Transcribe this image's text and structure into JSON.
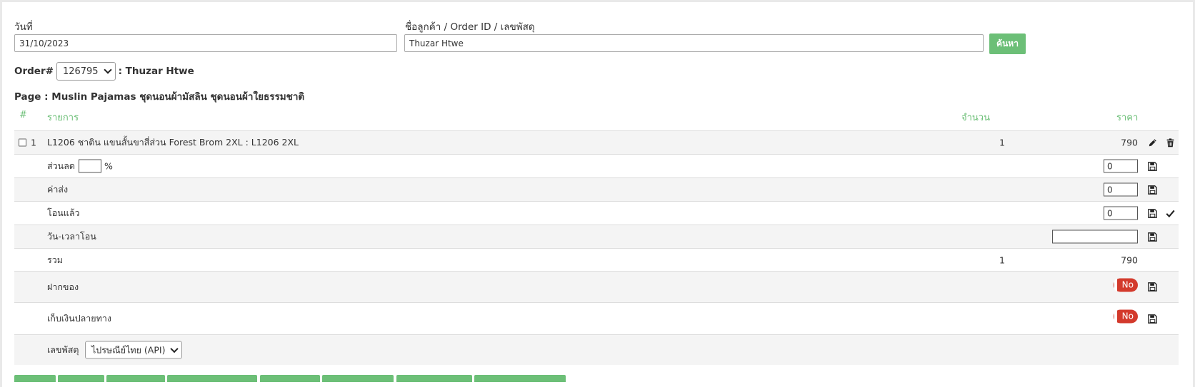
{
  "search": {
    "date_label": "วันที่",
    "date_value": "31/10/2023",
    "customer_label": "ชื่อลูกค้า / Order ID / เลขพัสดุ",
    "customer_value": "Thuzar Htwe",
    "search_button": "ค้นหา"
  },
  "order": {
    "label": "Order#",
    "selected": "126795",
    "customer_suffix": ": Thuzar Htwe"
  },
  "page_title": "Page : Muslin Pajamas ชุดนอนผ้ามัสลิน ชุดนอนผ้าใยธรรมชาติ",
  "table": {
    "headers": {
      "index": "#",
      "item": "รายการ",
      "qty": "จำนวน",
      "price": "ราคา"
    },
    "item": {
      "index": "1",
      "name": "L1206 ชาติน แขนสั้นขาสี่ส่วน Forest Brom 2XL : L1206 2XL",
      "qty": "1",
      "price": "790"
    },
    "discount": {
      "label": "ส่วนลด",
      "percent_value": "",
      "percent_sign": "%",
      "value": "0"
    },
    "shipping": {
      "label": "ค่าส่ง",
      "value": "0"
    },
    "transferred": {
      "label": "โอนแล้ว",
      "value": "0"
    },
    "transfer_time": {
      "label": "วัน-เวลาโอน",
      "value": ""
    },
    "total": {
      "label": "รวม",
      "qty": "1",
      "price": "790"
    },
    "deposit": {
      "label": "ฝากของ",
      "toggle": "No"
    },
    "cod": {
      "label": "เก็บเงินปลายทาง",
      "toggle": "No"
    },
    "tracking": {
      "label": "เลขพัสดุ",
      "selected": "ไปรษณีย์ไทย (API)"
    }
  },
  "colors": {
    "accent": "#6cbf77",
    "danger": "#d33a2c"
  },
  "icons": [
    "pencil-icon",
    "trash-icon",
    "save-icon",
    "check-icon",
    "chevron-down-icon"
  ]
}
